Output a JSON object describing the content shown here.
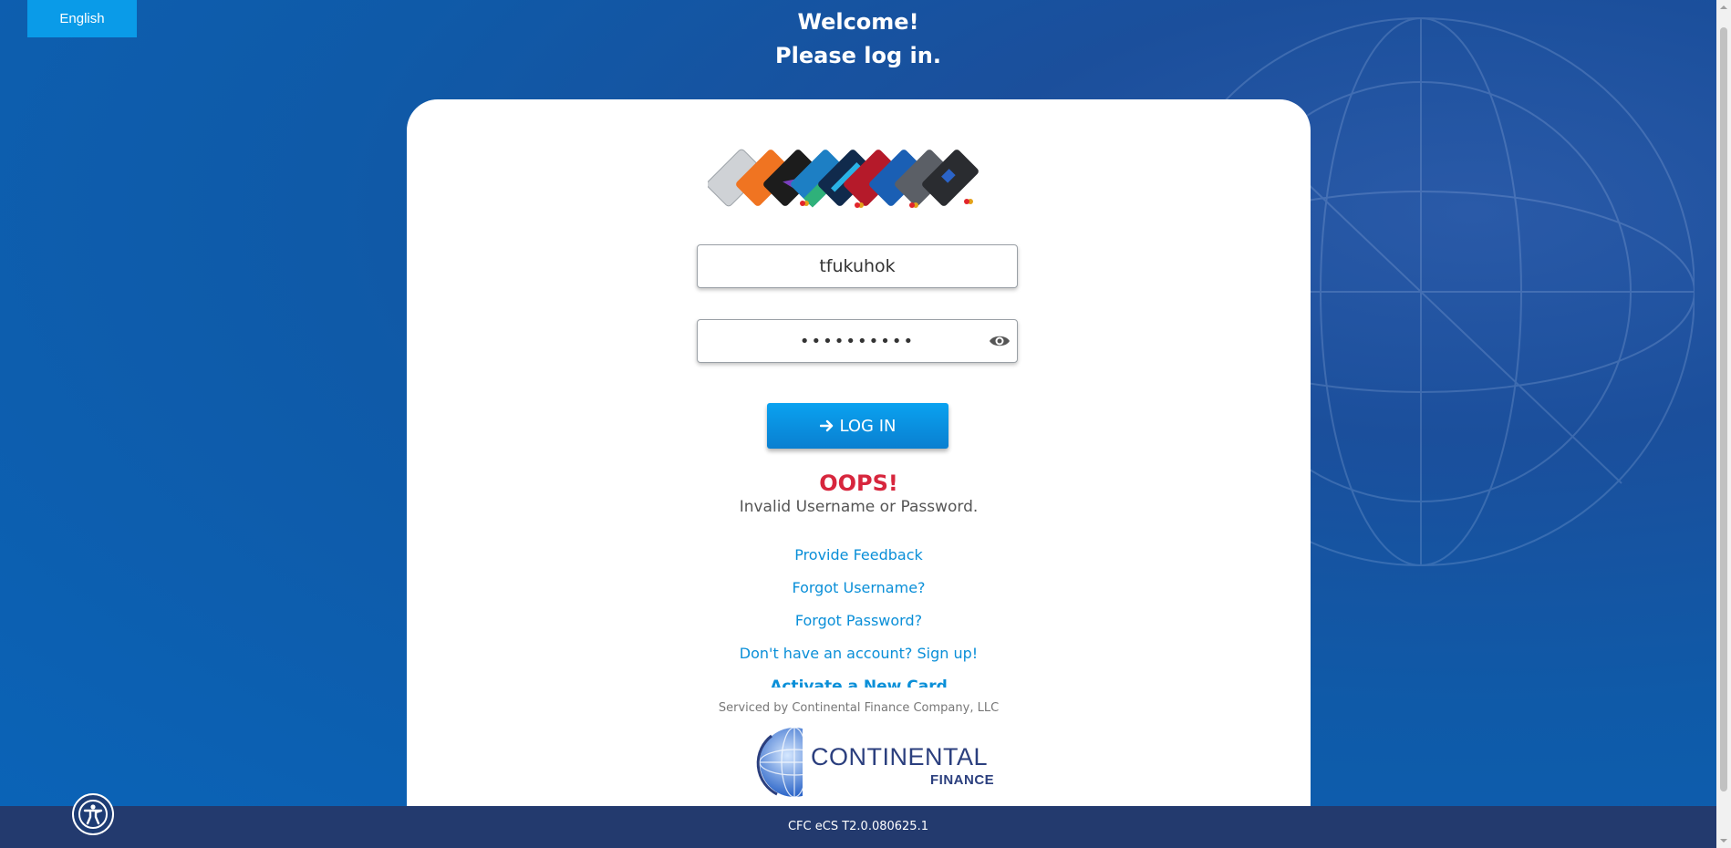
{
  "language_button": "English",
  "welcome": {
    "line1": "Welcome!",
    "line2": "Please log in."
  },
  "login_form": {
    "username_value": "tfukuhok",
    "password_value": "••••••••••",
    "login_label": "LOG IN",
    "login_icon": "arrow-right-icon",
    "show_password_icon": "eye-icon"
  },
  "error": {
    "title": "OOPS!",
    "message": "Invalid Username or Password."
  },
  "links": {
    "feedback": "Provide Feedback",
    "forgot_username": "Forgot Username?",
    "forgot_password": "Forgot Password?",
    "signup": "Don't have an account? Sign up!",
    "activate": "Activate a New Card"
  },
  "serviced_by": "Serviced by Continental Finance Company, LLC",
  "logo": {
    "name": "CONTINENTAL",
    "sub": "FINANCE"
  },
  "footer": {
    "version": "CFC eCS T2.0.080625.1"
  },
  "accessibility_icon": "accessibility-icon",
  "colors": {
    "primary": "#0a9be8",
    "error": "#d7263d",
    "link": "#0a8fd8",
    "footer": "#233a6e",
    "logo": "#2b3f7e"
  }
}
